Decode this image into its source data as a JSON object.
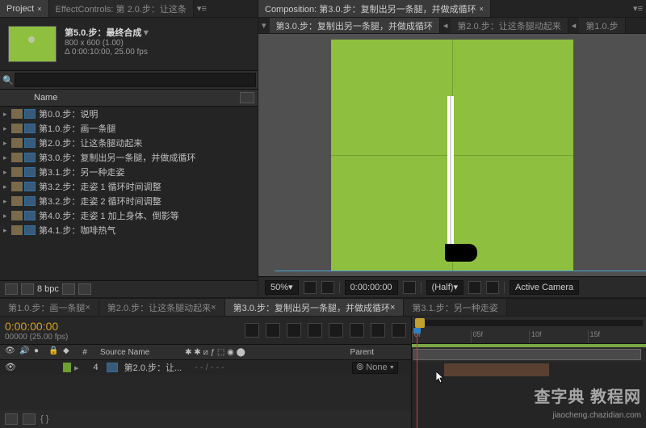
{
  "tabs": {
    "project": "Project",
    "effect_controls": "EffectControls: 第 2.0.步：让这条",
    "composition": "Composition: 第3.0.步：复制出另一条腿，并做成循环"
  },
  "comp_info": {
    "title": "第5.0.步：最终合成",
    "arrow": "▼",
    "dims": "800 x 600 (1.00)",
    "time": "Δ 0:00:10:00, 25.00 fps"
  },
  "name_header": "Name",
  "items": [
    "第0.0.步：说明",
    "第1.0.步：画一条腿",
    "第2.0.步：让这条腿动起来",
    "第3.0.步：复制出另一条腿，并做成循环",
    "第3.1.步：另一种走姿",
    "第3.2.步：走姿 1 循环时间调整",
    "第3.2.步：走姿 2 循环时间调整",
    "第4.0.步：走姿 1 加上身体、倒影等",
    "第4.1.步：咖啡热气"
  ],
  "footer": {
    "bpc": "8 bpc"
  },
  "viewer_tabs": [
    "第3.0.步：复制出另一条腿，并做成循环",
    "第2.0.步：让这条腿动起来",
    "第1.0.步"
  ],
  "viewer_footer": {
    "zoom": "50%",
    "time": "0:00:00:00",
    "res": "(Half)",
    "camera": "Active Camera"
  },
  "timeline_tabs": [
    "第1.0.步：画一条腿",
    "第2.0.步：让这条腿动起来",
    "第3.0.步：复制出另一条腿，并做成循环",
    "第3.1.步：另一种走姿"
  ],
  "timeline": {
    "time": "0:00:00:00",
    "fps": "00000 (25.00 fps)",
    "col_num": "#",
    "col_src": "Source Name",
    "col_parent": "Parent",
    "layer_num": "4",
    "layer_name": "第2.0.步：让...",
    "layer_parent": "None",
    "ticks": [
      "0f",
      "05f",
      "10f",
      "15f"
    ]
  },
  "watermark1": "查字典 教程网",
  "watermark2": "jiaocheng.chazidian.com"
}
